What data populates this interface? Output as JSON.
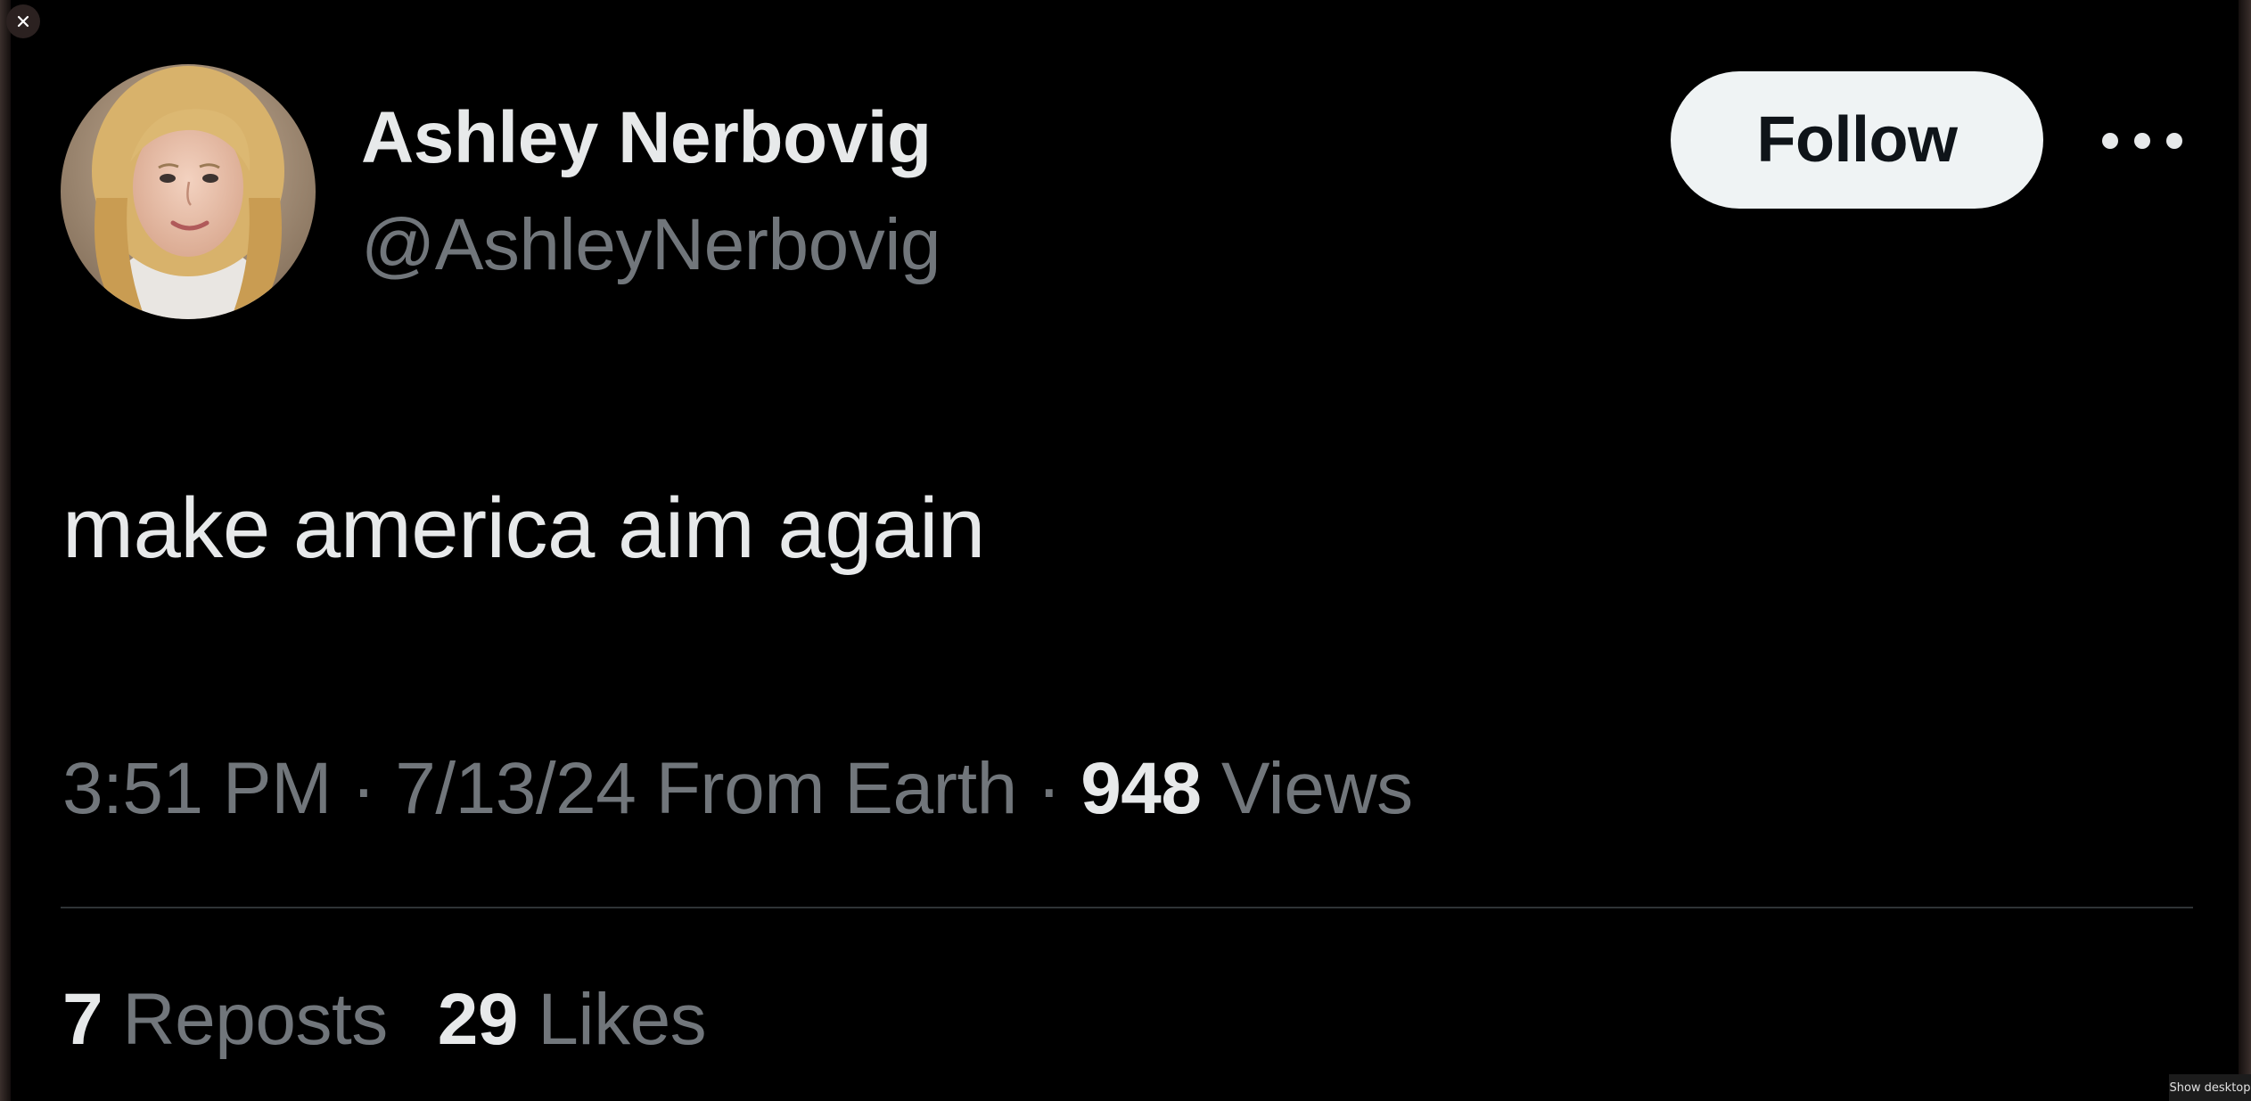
{
  "window": {
    "close_icon": "close-icon",
    "show_desktop_label": "Show desktop"
  },
  "tweet": {
    "author": {
      "display_name": "Ashley Nerbovig",
      "handle": "@AshleyNerbovig",
      "avatar": "avatar-photo"
    },
    "follow_label": "Follow",
    "more_icon": "more-horizontal-icon",
    "text": "make america aim again",
    "meta": {
      "time": "3:51 PM",
      "separator": "·",
      "date": "7/13/24",
      "location": "From Earth",
      "views_count": "948",
      "views_label": "Views"
    },
    "stats": {
      "reposts_count": "7",
      "reposts_label": "Reposts",
      "likes_count": "29",
      "likes_label": "Likes"
    }
  },
  "colors": {
    "background": "#000000",
    "primary_text": "#e7e9ea",
    "secondary_text": "#71767b",
    "follow_button_bg": "#eff3f4",
    "divider": "#2f3336"
  }
}
